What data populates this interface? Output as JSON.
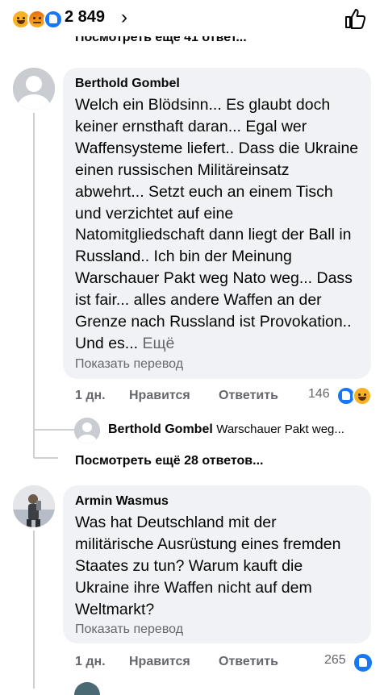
{
  "header": {
    "reactions_count": "2 849",
    "chevron": "›",
    "reaction_icons": [
      "haha-icon",
      "angry-icon",
      "like-icon"
    ]
  },
  "top_partial_link": "Посмотреть ещё 41 ответ...",
  "comments": [
    {
      "author": "Berthold Gombel",
      "text": "Welch ein Blödsinn... Es glaubt doch keiner ernsthaft daran... Egal wer Waffensysteme liefert.. Dass die Ukraine einen russischen Militäreinsatz abwehrt... Setzt euch an einem Tisch und verzichtet auf eine Natomitgliedschaft dann liegt der Ball in Russland.. Ich bin der Meinung Warschauer Pakt weg Nato weg... Dass ist fair... alles andere Waffen an der Grenze nach Russland ist Provokation.. Und es...",
      "see_more": "Ещё",
      "translate": "Показать перевод",
      "time": "1 дн.",
      "like": "Нравится",
      "reply": "Ответить",
      "reaction_count": "146",
      "reply_preview": {
        "name": "Berthold Gombel",
        "snippet": "Warschauer Pakt weg..."
      },
      "more_replies": "Посмотреть ещё 28 ответов..."
    },
    {
      "author": "Armin Wasmus",
      "text": "Was hat Deutschland mit der militärische Ausrüstung eines fremden Staates zu tun? Warum kauft die Ukraine ihre Waffen nicht auf dem Weltmarkt?",
      "translate": "Показать перевод",
      "time": "1 дн.",
      "like": "Нравится",
      "reply": "Ответить",
      "reaction_count": "265"
    }
  ],
  "colors": {
    "like_blue": "#1877f2",
    "haha_yellow": "#f7b125",
    "bubble_bg": "#f0f2f5",
    "secondary_text": "#65676b"
  }
}
